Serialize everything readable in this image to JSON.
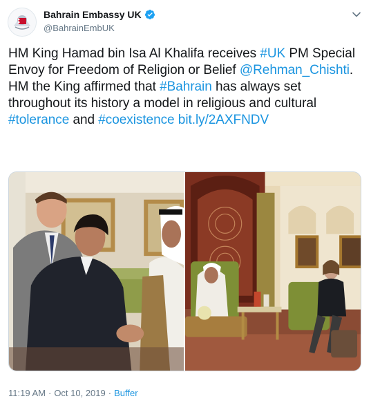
{
  "account": {
    "display_name": "Bahrain Embassy UK",
    "handle": "@BahrainEmbUK"
  },
  "icons": {
    "verified": "verified-badge-icon",
    "menu": "chevron-down-icon"
  },
  "colors": {
    "link": "#1b95e0",
    "verified": "#1da1f2",
    "muted": "#657786"
  },
  "tweet": {
    "text_1": "HM King Hamad bin Isa Al Khalifa receives ",
    "hashtag_uk": "#UK",
    "text_2": " PM Special Envoy for Freedom of Religion or Belief ",
    "mention": "@Rehman_Chishti",
    "text_3": ". HM the King affirmed that ",
    "hashtag_bahrain": "#Bahrain",
    "text_4": " has always set throughout its history a model in religious and cultural ",
    "hashtag_tolerance": "#tolerance",
    "text_5": " and ",
    "hashtag_coexistence": "#coexistence",
    "text_6": " ",
    "link": "bit.ly/2AXFNDV"
  },
  "footer": {
    "time": "11:19 AM",
    "separator": "·",
    "date": "Oct 10, 2019",
    "source": "Buffer"
  }
}
